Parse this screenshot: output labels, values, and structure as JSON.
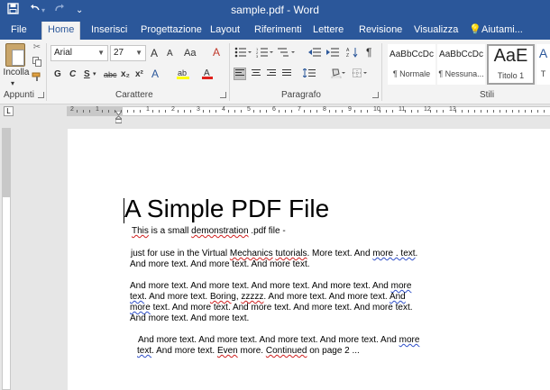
{
  "window": {
    "title": "sample.pdf - Word",
    "quick_access": {
      "save_icon": "save-icon",
      "undo_icon": "undo-icon",
      "redo_icon": "redo-icon",
      "customize": "⌄"
    }
  },
  "tabs": [
    "File",
    "Home",
    "Inserisci",
    "Progettazione",
    "Layout",
    "Riferimenti",
    "Lettere",
    "Revisione",
    "Visualizza",
    "Aiutami..."
  ],
  "active_tab": "Home",
  "ribbon": {
    "clipboard": {
      "paste_label": "Incolla",
      "group_label": "Appunti"
    },
    "font": {
      "font_name": "Arial",
      "font_size": "27",
      "group_label": "Carattere",
      "bold": "G",
      "italic": "C",
      "underline": "S",
      "strike": "abc",
      "subscript": "x₂",
      "superscript": "x²",
      "grow": "A",
      "shrink": "A",
      "case": "Aa",
      "clear": "A"
    },
    "paragraph": {
      "group_label": "Paragrafo",
      "pilcrow": "¶"
    },
    "styles": {
      "group_label": "Stili",
      "items": [
        {
          "preview": "AaBbCcDc",
          "name": "¶ Normale"
        },
        {
          "preview": "AaBbCcDc",
          "name": "¶ Nessuna..."
        },
        {
          "preview": "AaE",
          "name": "Titolo 1"
        },
        {
          "preview": "A",
          "name": "T"
        }
      ]
    }
  },
  "ruler": {
    "tab_selector": "L",
    "numbers": [
      "2",
      "1",
      "1",
      "2",
      "3",
      "4",
      "5",
      "6",
      "7",
      "8",
      "9",
      "10",
      "11",
      "12",
      "13"
    ]
  },
  "document": {
    "heading": "A Simple PDF File",
    "line1_a": "This",
    "line1_b": " is a small ",
    "line1_c": "demonstration",
    "line1_d": " .pdf file -",
    "p2_l1_a": "just for use in the Virtual ",
    "p2_l1_b": "Mechanics",
    "p2_l1_c": " ",
    "p2_l1_d": "tutorials",
    "p2_l1_e": ". More text. And ",
    "p2_l1_f": "more . text",
    "p2_l1_g": ".",
    "p2_l2": "And more text. And more text. And more text.",
    "p3_l1_a": "And more text. And more text. And more text. And more text. And ",
    "p3_l1_b": "more",
    "p3_l2_a": "text",
    "p3_l2_b": ". And more text. ",
    "p3_l2_c": "Boring",
    "p3_l2_d": ", ",
    "p3_l2_e": "zzzzz",
    "p3_l2_f": ". And more text. And more text. ",
    "p3_l2_g": "And",
    "p3_l3_a": "more",
    "p3_l3_b": " text. And more text. And more text. And more text. And more text.",
    "p3_l4": "And more text. And more text.",
    "p4_l1_a": "And more text. And more text. And more text. And more text. And ",
    "p4_l1_b": "more",
    "p4_l2_a": "text",
    "p4_l2_b": ". And more text. ",
    "p4_l2_c": "Even",
    "p4_l2_d": " more. ",
    "p4_l2_e": "Continued",
    "p4_l2_f": " on page 2 ..."
  }
}
